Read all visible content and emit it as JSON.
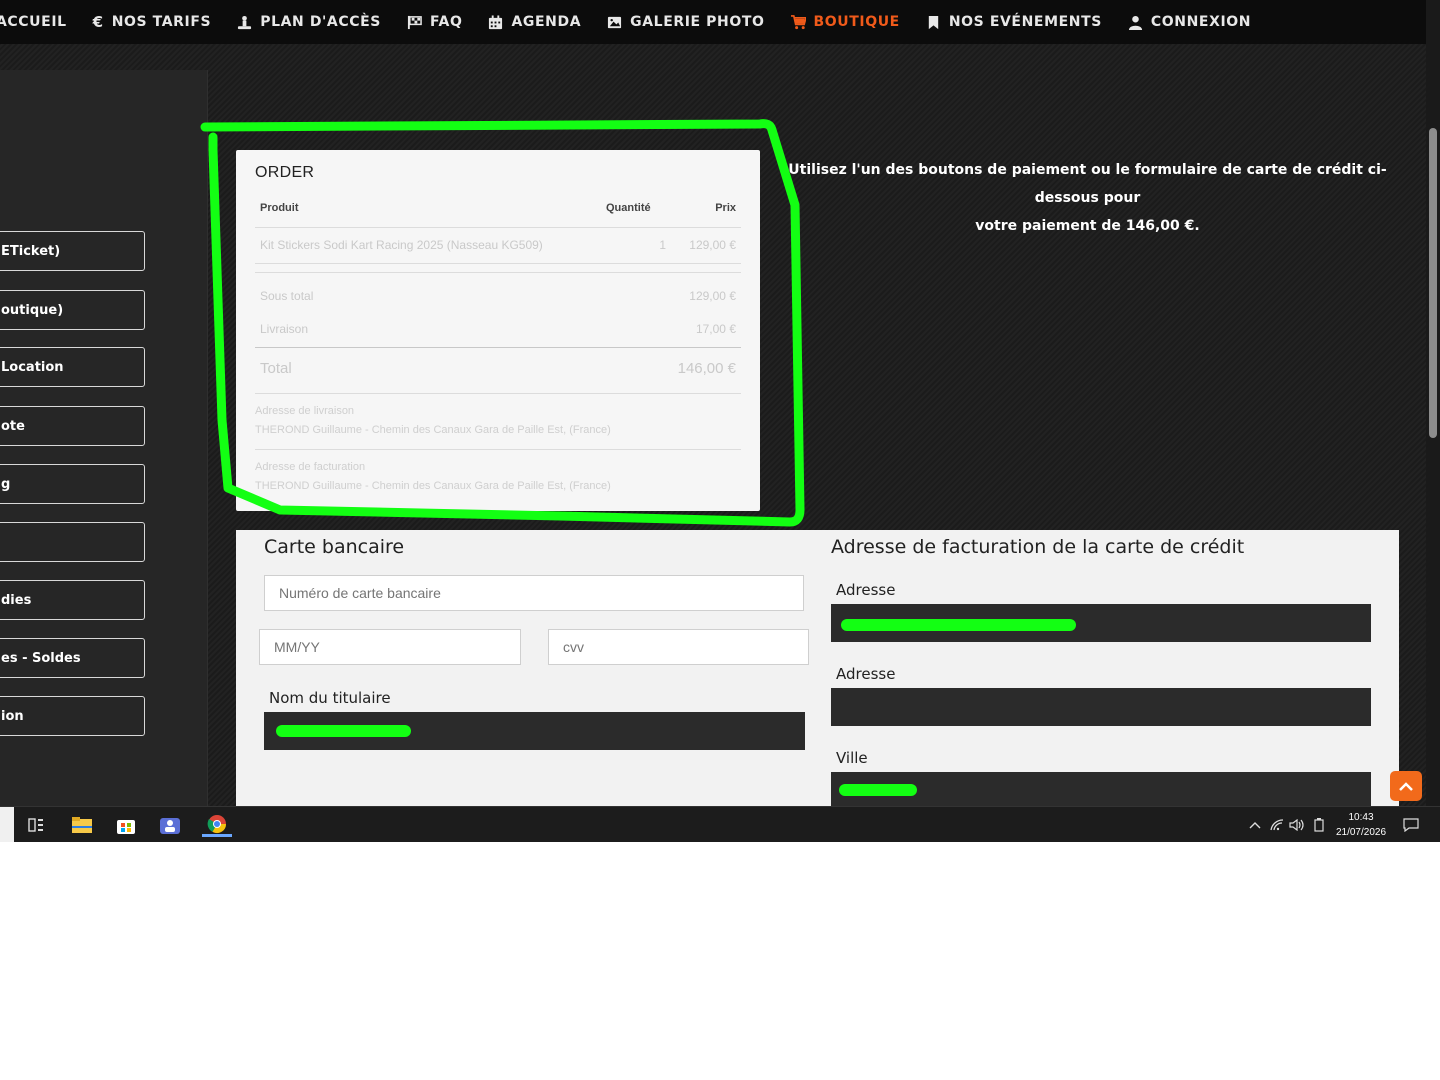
{
  "nav": {
    "items": [
      {
        "label": "ACCUEIL",
        "icon": "none"
      },
      {
        "label": "NOS TARIFS",
        "icon": "euro-icon"
      },
      {
        "label": "PLAN D'ACCÈS",
        "icon": "person-pin-icon"
      },
      {
        "label": "FAQ",
        "icon": "flag-icon"
      },
      {
        "label": "AGENDA",
        "icon": "calendar-icon"
      },
      {
        "label": "GALERIE PHOTO",
        "icon": "image-icon"
      },
      {
        "label": "BOUTIQUE",
        "icon": "cart-icon",
        "active": true
      },
      {
        "label": "NOS EVÉNEMENTS",
        "icon": "bookmark-icon"
      },
      {
        "label": "CONNEXION",
        "icon": "user-icon"
      }
    ],
    "active_color": "#f05a1a"
  },
  "sidebar": {
    "items": [
      "ETicket)",
      "outique)",
      "Location",
      "ote",
      "g",
      "",
      "dies",
      "es - Soldes",
      "ion"
    ]
  },
  "order": {
    "title": "ORDER",
    "headers": {
      "product": "Produit",
      "quantity": "Quantité",
      "price": "Prix"
    },
    "line": {
      "product": "Kit Stickers Sodi Kart Racing 2025 (Nasseau KG509)",
      "quantity": "1",
      "price": "129,00 €"
    },
    "subtotal_label": "Sous total",
    "subtotal": "129,00 €",
    "shipping_label": "Livraison",
    "shipping": "17,00 €",
    "total_label": "Total",
    "total": "146,00 €",
    "shipping_address_label": "Adresse de livraison",
    "shipping_address": "THEROND Guillaume - Chemin des Canaux Gara de Paille Est, (France)",
    "billing_address_label": "Adresse de facturation",
    "billing_address": "THEROND Guillaume - Chemin des Canaux Gara de Paille Est, (France)"
  },
  "payment_info": {
    "line1": "Utilisez l'un des boutons de paiement ou le formulaire de carte de crédit ci-dessous pour",
    "line2": "votre paiement de 146,00 €."
  },
  "card": {
    "title": "Carte bancaire",
    "number_placeholder": "Numéro de carte bancaire",
    "expiry_placeholder": "MM/YY",
    "cvv_placeholder": "cvv",
    "holder_label": "Nom du titulaire"
  },
  "billing": {
    "title": "Adresse de facturation de la carte de crédit",
    "address1_label": "Adresse",
    "address2_label": "Adresse",
    "city_label": "Ville"
  },
  "taskbar": {
    "time": "10:43",
    "date": "21/07/2026"
  },
  "colors": {
    "annotation": "#13ff13",
    "accent": "#f26a1b"
  }
}
